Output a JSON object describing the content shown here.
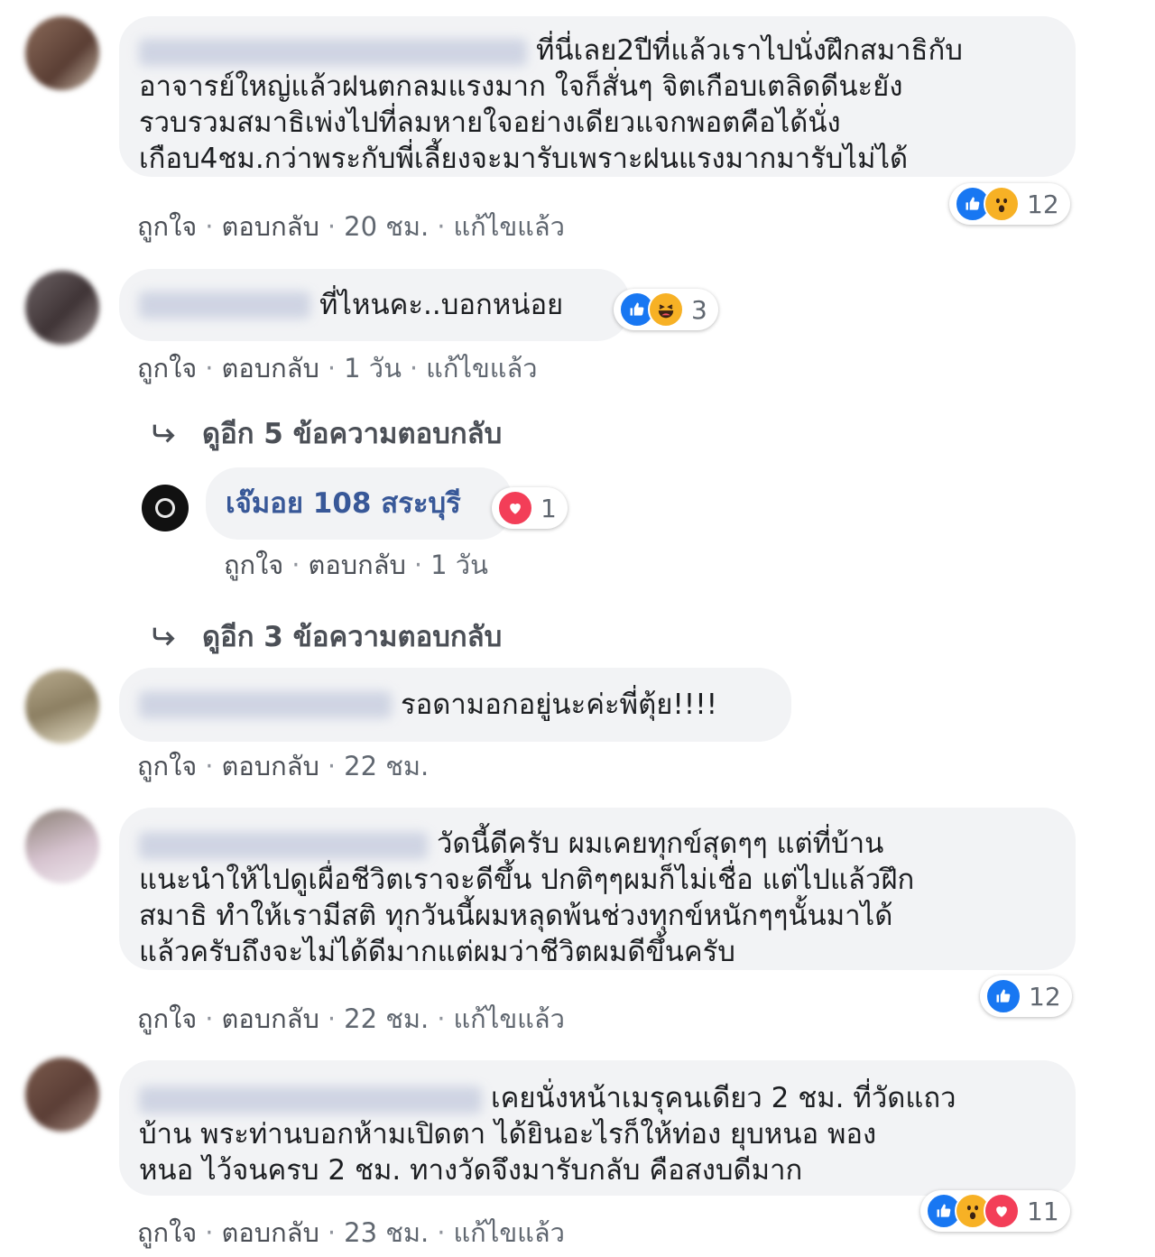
{
  "colors": {
    "accent": "#1877f2",
    "bubble": "#f2f3f5",
    "meta": "#606770",
    "love": "#f33e58",
    "wow": "#f7b125"
  },
  "actions": {
    "like": "ถูกใจ",
    "reply": "ตอบกลับ",
    "separator": "·"
  },
  "comments": [
    {
      "lines": [
        "ที่นี่เลย2ปีที่แล้วเราไปนั่งฝึกสมาธิกับ",
        "อาจารย์ใหญ่แล้วฝนตกลมแรงมาก ใจก็สั่นๆ จิตเกือบเตลิดดีนะยัง",
        "รวบรวมสมาธิเพ่งไปที่ลมหายใจอย่างเดียวแจกพอตคือได้นั่ง",
        "เกือบ4ชม.กว่าพระกับพี่เลี้ยงจะมารับเพราะฝนแรงมากมารับไม่ได้"
      ],
      "time": "20 ชม.",
      "edited": "แก้ไขแล้ว",
      "reactions": [
        "like-icon",
        "wow-icon"
      ],
      "reaction_count": "12"
    },
    {
      "lines": [
        "ที่ไหนคะ..บอกหน่อย"
      ],
      "time": "1 วัน",
      "edited": "แก้ไขแล้ว",
      "reactions": [
        "like-icon",
        "haha-icon"
      ],
      "reaction_count": "3",
      "more_replies_top": "ดูอีก 5 ข้อความตอบกลับ",
      "reply": {
        "author": "เจ๊มอย 108 สระบุรี",
        "time": "1 วัน",
        "reactions": [
          "love-icon"
        ],
        "reaction_count": "1"
      },
      "more_replies_bottom": "ดูอีก 3 ข้อความตอบกลับ"
    },
    {
      "lines": [
        "รอดามอกอยู่นะค่ะพี่ตุ้ย!!!!"
      ],
      "time": "22 ชม."
    },
    {
      "lines": [
        "วัดนี้ดีครับ ผมเคยทุกข์สุดๆๆ แต่ที่บ้าน",
        "แนะนำให้ไปดูเผื่อชีวิตเราจะดีขึ้น ปกติๆๆผมก็ไม่เชื่อ แต่ไปแล้วฝึก",
        "สมาธิ ทำให้เรามีสติ ทุกวันนี้ผมหลุดพ้นช่วงทุกข์หนักๆๆนั้นมาได้",
        "แล้วครับถึงจะไม่ได้ดีมากแต่ผมว่าชีวิตผมดีขึ้นครับ"
      ],
      "time": "22 ชม.",
      "edited": "แก้ไขแล้ว",
      "reactions": [
        "like-icon"
      ],
      "reaction_count": "12"
    },
    {
      "lines": [
        "เคยนั่งหน้าเมรุคนเดียว 2 ชม. ที่วัดแถว",
        "บ้าน พระท่านบอกห้ามเปิดตา ได้ยินอะไรก็ให้ท่อง ยุบหนอ พอง",
        "หนอ ไว้จนครบ 2 ชม. ทางวัดจึงมารับกลับ คือสงบดีมาก"
      ],
      "time": "23 ชม.",
      "edited": "แก้ไขแล้ว",
      "reactions": [
        "like-icon",
        "wow-icon",
        "love-icon"
      ],
      "reaction_count": "11"
    }
  ]
}
